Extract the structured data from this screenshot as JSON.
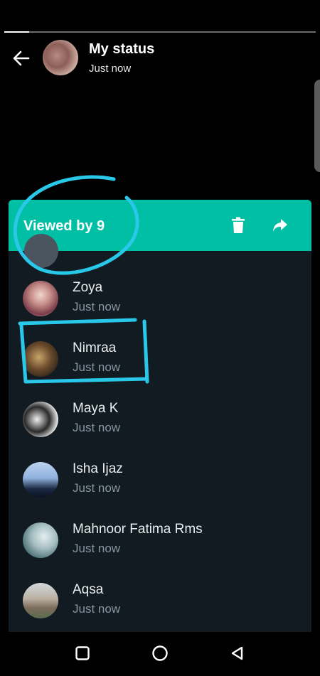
{
  "header": {
    "title": "My status",
    "subtitle": "Just now",
    "progress": 0.08
  },
  "sheet": {
    "title": "Viewed by 9"
  },
  "viewers": [
    {
      "name": "Zoya",
      "time": "Just now"
    },
    {
      "name": "Nimraa",
      "time": "Just now"
    },
    {
      "name": "Maya K",
      "time": "Just now"
    },
    {
      "name": "Isha Ijaz",
      "time": "Just now"
    },
    {
      "name": "Mahnoor Fatima Rms",
      "time": "Just now"
    },
    {
      "name": "Aqsa",
      "time": "Just now"
    }
  ],
  "colors": {
    "accent": "#00bfa5",
    "sheet_background": "#111b21",
    "secondary_text": "#8696a0",
    "annotation": "#29c8e8"
  },
  "icons": {
    "back": "arrow-left-icon",
    "delete": "trash-icon",
    "forward": "share-forward-icon",
    "nav_recent": "square-icon",
    "nav_home": "circle-icon",
    "nav_back": "triangle-back-icon"
  }
}
